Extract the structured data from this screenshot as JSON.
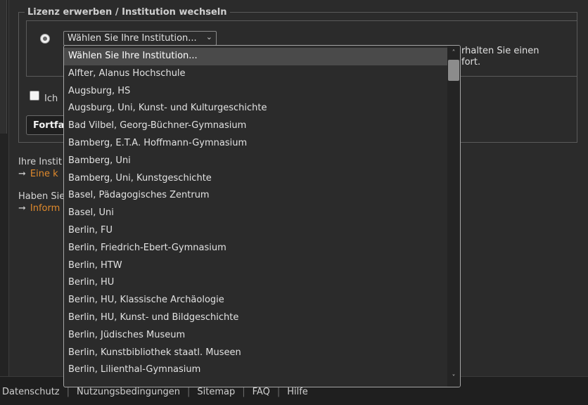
{
  "license_section": {
    "legend": "Lizenz erwerben / Institution wechseln",
    "select_value": "Wählen Sie Ihre Institution...",
    "partial_text_line1": "rhalten Sie einen",
    "partial_text_line2": "fort.",
    "checkbox_label": "Ich",
    "continue_button": "Fortfa"
  },
  "info": {
    "line1": "Ihre Instit",
    "link1": "Eine k",
    "line2": "Haben Sie",
    "link2": "Inform"
  },
  "footer": {
    "links": [
      "Datenschutz",
      "Nutzungsbedingungen",
      "Sitemap",
      "FAQ",
      "Hilfe"
    ],
    "separator": "|"
  },
  "dropdown": {
    "options": [
      "Wählen Sie Ihre Institution...",
      "Alfter, Alanus Hochschule",
      "Augsburg, HS",
      "Augsburg, Uni, Kunst- und Kulturgeschichte",
      "Bad Vilbel, Georg-Büchner-Gymnasium",
      "Bamberg, E.T.A. Hoffmann-Gymnasium",
      "Bamberg, Uni",
      "Bamberg, Uni, Kunstgeschichte",
      "Basel, Pädagogisches Zentrum",
      "Basel, Uni",
      "Berlin, FU",
      "Berlin, Friedrich-Ebert-Gymnasium",
      "Berlin, HTW",
      "Berlin, HU",
      "Berlin, HU, Klassische Archäologie",
      "Berlin, HU, Kunst- und Bildgeschichte",
      "Berlin, Jüdisches Museum",
      "Berlin, Kunstbibliothek staatl. Museen",
      "Berlin, Lilienthal-Gymnasium"
    ],
    "selected_index": 0
  },
  "icons": {
    "arrow": "➞",
    "chevron": "⌄",
    "scroll_up": "˄",
    "scroll_down": "˅"
  },
  "colors": {
    "background": "#2b2b2b",
    "link": "#e08a2c",
    "selected_option": "#4a4a4a"
  }
}
